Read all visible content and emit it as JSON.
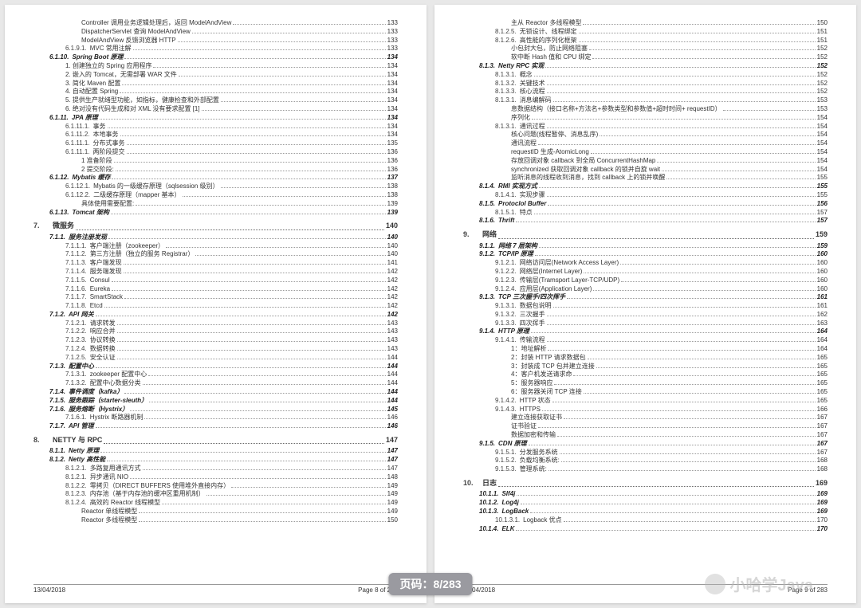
{
  "footer_date": "13/04/2018",
  "left_footer": "Page 8 of 283",
  "right_footer": "Page 9 of 283",
  "badge": "页码：8/283",
  "watermark": "小哈学Java",
  "left": [
    {
      "i": 3,
      "n": "",
      "t": "Controller 调用业务逻辑处理后，返回 ModelAndView",
      "p": "133"
    },
    {
      "i": 3,
      "n": "",
      "t": "DispatcherServlet 查询 ModelAndView",
      "p": "133"
    },
    {
      "i": 3,
      "n": "",
      "t": "ModelAndView 反馈浏览器 HTTP",
      "p": "133"
    },
    {
      "i": 2,
      "n": "6.1.9.1.",
      "t": "MVC 常用注解",
      "p": "133"
    },
    {
      "i": 1,
      "n": "6.1.10.",
      "t": "Spring Boot 原理",
      "p": "134",
      "style": "italic"
    },
    {
      "i": 2,
      "n": "",
      "t": "1. 创建独立的 Spring 应用程序",
      "p": "134"
    },
    {
      "i": 2,
      "n": "",
      "t": "2. 嵌入的 Tomcat，无需部署 WAR 文件",
      "p": "134"
    },
    {
      "i": 2,
      "n": "",
      "t": "3. 简化 Maven 配置",
      "p": "134"
    },
    {
      "i": 2,
      "n": "",
      "t": "4. 自动配置 Spring",
      "p": "134"
    },
    {
      "i": 2,
      "n": "",
      "t": "5. 提供生产就绪型功能，如指标，健康检查和外部配置",
      "p": "134"
    },
    {
      "i": 2,
      "n": "",
      "t": "6. 绝对没有代码生成和对 XML 没有要求配置 [1]",
      "p": "134"
    },
    {
      "i": 1,
      "n": "6.1.11.",
      "t": "JPA 原理",
      "p": "134",
      "style": "italic"
    },
    {
      "i": 2,
      "n": "6.1.11.1.",
      "t": "事务",
      "p": "134"
    },
    {
      "i": 2,
      "n": "6.1.11.2.",
      "t": "本地事务",
      "p": "134"
    },
    {
      "i": 2,
      "n": "6.1.11.1.",
      "t": "分布式事务",
      "p": "135"
    },
    {
      "i": 2,
      "n": "6.1.11.1.",
      "t": "两阶段提交",
      "p": "136"
    },
    {
      "i": 3,
      "n": "",
      "t": "1 准备阶段",
      "p": "136"
    },
    {
      "i": 3,
      "n": "",
      "t": "2 提交阶段:",
      "p": "136"
    },
    {
      "i": 1,
      "n": "6.1.12.",
      "t": "Mybatis 缓存",
      "p": "137",
      "style": "italic"
    },
    {
      "i": 2,
      "n": "6.1.12.1.",
      "t": "Mybatis 的一级缓存原理（sqlsession 级别）",
      "p": "138"
    },
    {
      "i": 2,
      "n": "6.1.12.2.",
      "t": "二级缓存原理（mapper 基本）",
      "p": "138"
    },
    {
      "i": 3,
      "n": "",
      "t": "具体使用需要配置:",
      "p": "139"
    },
    {
      "i": 1,
      "n": "6.1.13.",
      "t": "Tomcat 架构",
      "p": "139",
      "style": "italic"
    },
    {
      "i": 0,
      "n": "7.",
      "t": "微服务",
      "p": "140",
      "style": "chapter"
    },
    {
      "i": 1,
      "n": "7.1.1.",
      "t": "服务注册发现",
      "p": "140",
      "style": "italic"
    },
    {
      "i": 2,
      "n": "7.1.1.1.",
      "t": "客户端注册（zookeeper）",
      "p": "140"
    },
    {
      "i": 2,
      "n": "7.1.1.2.",
      "t": "第三方注册（独立的服务 Registrar）",
      "p": "140"
    },
    {
      "i": 2,
      "n": "7.1.1.3.",
      "t": "客户端发现",
      "p": "141"
    },
    {
      "i": 2,
      "n": "7.1.1.4.",
      "t": "服务端发现",
      "p": "142"
    },
    {
      "i": 2,
      "n": "7.1.1.5.",
      "t": "Consul",
      "p": "142"
    },
    {
      "i": 2,
      "n": "7.1.1.6.",
      "t": "Eureka",
      "p": "142"
    },
    {
      "i": 2,
      "n": "7.1.1.7.",
      "t": "SmartStack",
      "p": "142"
    },
    {
      "i": 2,
      "n": "7.1.1.8.",
      "t": "Etcd",
      "p": "142"
    },
    {
      "i": 1,
      "n": "7.1.2.",
      "t": "API 网关",
      "p": "142",
      "style": "italic"
    },
    {
      "i": 2,
      "n": "7.1.2.1.",
      "t": "请求转发",
      "p": "143"
    },
    {
      "i": 2,
      "n": "7.1.2.2.",
      "t": "响应合并",
      "p": "143"
    },
    {
      "i": 2,
      "n": "7.1.2.3.",
      "t": "协议转换",
      "p": "143"
    },
    {
      "i": 2,
      "n": "7.1.2.4.",
      "t": "数据转换",
      "p": "143"
    },
    {
      "i": 2,
      "n": "7.1.2.5.",
      "t": "安全认证",
      "p": "144"
    },
    {
      "i": 1,
      "n": "7.1.3.",
      "t": "配置中心",
      "p": "144",
      "style": "italic"
    },
    {
      "i": 2,
      "n": "7.1.3.1.",
      "t": "zookeeper 配置中心",
      "p": "144"
    },
    {
      "i": 2,
      "n": "7.1.3.2.",
      "t": "配置中心数据分类",
      "p": "144"
    },
    {
      "i": 1,
      "n": "7.1.4.",
      "t": "事件调度（kafka）",
      "p": "144",
      "style": "italic"
    },
    {
      "i": 1,
      "n": "7.1.5.",
      "t": "服务跟踪（starter-sleuth）",
      "p": "144",
      "style": "italic"
    },
    {
      "i": 1,
      "n": "7.1.6.",
      "t": "服务熔断（Hystrix）",
      "p": "145",
      "style": "italic"
    },
    {
      "i": 2,
      "n": "7.1.6.1.",
      "t": "Hystrix 断路器机制",
      "p": "146"
    },
    {
      "i": 1,
      "n": "7.1.7.",
      "t": "API 管理",
      "p": "146",
      "style": "italic"
    },
    {
      "i": 0,
      "n": "8.",
      "t": "NETTY 与 RPC",
      "p": "147",
      "style": "chapter"
    },
    {
      "i": 1,
      "n": "8.1.1.",
      "t": "Netty 原理",
      "p": "147",
      "style": "italic"
    },
    {
      "i": 1,
      "n": "8.1.2.",
      "t": "Netty 高性能",
      "p": "147",
      "style": "italic"
    },
    {
      "i": 2,
      "n": "8.1.2.1.",
      "t": "多路复用通讯方式",
      "p": "147"
    },
    {
      "i": 2,
      "n": "8.1.2.1.",
      "t": "异步通讯 NIO",
      "p": "148"
    },
    {
      "i": 2,
      "n": "8.1.2.2.",
      "t": "零拷贝（DIRECT BUFFERS 使用堆外直接内存）",
      "p": "149"
    },
    {
      "i": 2,
      "n": "8.1.2.3.",
      "t": "内存池（基于内存池的缓冲区重用机制）",
      "p": "149"
    },
    {
      "i": 2,
      "n": "8.1.2.4.",
      "t": "高效的 Reactor 线程模型",
      "p": "149"
    },
    {
      "i": 3,
      "n": "",
      "t": "Reactor 单线程模型",
      "p": "149"
    },
    {
      "i": 3,
      "n": "",
      "t": "Reactor 多线程模型",
      "p": "150"
    }
  ],
  "right": [
    {
      "i": 3,
      "n": "",
      "t": "主从 Reactor 多线程模型",
      "p": "150"
    },
    {
      "i": 2,
      "n": "8.1.2.5.",
      "t": "无锁设计、线程绑定",
      "p": "151"
    },
    {
      "i": 2,
      "n": "8.1.2.6.",
      "t": "高性能的序列化框架",
      "p": "151"
    },
    {
      "i": 3,
      "n": "",
      "t": "小包封大包，防止网络阻塞",
      "p": "152"
    },
    {
      "i": 3,
      "n": "",
      "t": "软中断 Hash 值和 CPU 绑定",
      "p": "152"
    },
    {
      "i": 1,
      "n": "8.1.3.",
      "t": "Netty RPC 实现",
      "p": "152",
      "style": "italic"
    },
    {
      "i": 2,
      "n": "8.1.3.1.",
      "t": "概念",
      "p": "152"
    },
    {
      "i": 2,
      "n": "8.1.3.2.",
      "t": "关键技术",
      "p": "152"
    },
    {
      "i": 2,
      "n": "8.1.3.3.",
      "t": "核心流程",
      "p": "152"
    },
    {
      "i": 2,
      "n": "8.1.3.1.",
      "t": "消息编解码",
      "p": "153"
    },
    {
      "i": 3,
      "n": "",
      "t": "息数据结构（接口名称+方法名+参数类型和参数值+超时时间+ requestID）",
      "p": "153"
    },
    {
      "i": 3,
      "n": "",
      "t": "序列化",
      "p": "154"
    },
    {
      "i": 2,
      "n": "8.1.3.1.",
      "t": "通讯过程",
      "p": "154"
    },
    {
      "i": 3,
      "n": "",
      "t": "核心问题(线程暂停、消息乱序)",
      "p": "154"
    },
    {
      "i": 3,
      "n": "",
      "t": "通讯流程",
      "p": "154"
    },
    {
      "i": 3,
      "n": "",
      "t": "requestID 生成-AtomicLong",
      "p": "154"
    },
    {
      "i": 3,
      "n": "",
      "t": "存放回调对象 callback 到全局 ConcurrentHashMap",
      "p": "154"
    },
    {
      "i": 3,
      "n": "",
      "t": "synchronized 获取回调对象 callback 的锁并自旋 wait",
      "p": "154"
    },
    {
      "i": 3,
      "n": "",
      "t": "监听消息的线程收到消息，找到 callback 上的锁并唤醒",
      "p": "155"
    },
    {
      "i": 1,
      "n": "8.1.4.",
      "t": "RMI 实现方式",
      "p": "155",
      "style": "italic"
    },
    {
      "i": 2,
      "n": "8.1.4.1.",
      "t": "实现步骤",
      "p": "155"
    },
    {
      "i": 1,
      "n": "8.1.5.",
      "t": "Protoclol Buffer",
      "p": "156",
      "style": "italic"
    },
    {
      "i": 2,
      "n": "8.1.5.1.",
      "t": "特点",
      "p": "157"
    },
    {
      "i": 1,
      "n": "8.1.6.",
      "t": "Thrift",
      "p": "157",
      "style": "italic"
    },
    {
      "i": 0,
      "n": "9.",
      "t": "网络",
      "p": "159",
      "style": "chapter"
    },
    {
      "i": 1,
      "n": "9.1.1.",
      "t": "网络 7 层架构",
      "p": "159",
      "style": "italic"
    },
    {
      "i": 1,
      "n": "9.1.2.",
      "t": "TCP/IP 原理",
      "p": "160",
      "style": "italic"
    },
    {
      "i": 2,
      "n": "9.1.2.1.",
      "t": "网络访问层(Network Access Layer)",
      "p": "160"
    },
    {
      "i": 2,
      "n": "9.1.2.2.",
      "t": "网络层(Internet Layer)",
      "p": "160"
    },
    {
      "i": 2,
      "n": "9.1.2.3.",
      "t": "传输层(Tramsport Layer-TCP/UDP)",
      "p": "160"
    },
    {
      "i": 2,
      "n": "9.1.2.4.",
      "t": "应用层(Application Layer)",
      "p": "160"
    },
    {
      "i": 1,
      "n": "9.1.3.",
      "t": "TCP 三次握手/四次挥手",
      "p": "161",
      "style": "italic"
    },
    {
      "i": 2,
      "n": "9.1.3.1.",
      "t": "数据包说明",
      "p": "161"
    },
    {
      "i": 2,
      "n": "9.1.3.2.",
      "t": "三次握手",
      "p": "162"
    },
    {
      "i": 2,
      "n": "9.1.3.3.",
      "t": "四次挥手",
      "p": "163"
    },
    {
      "i": 1,
      "n": "9.1.4.",
      "t": "HTTP 原理",
      "p": "164",
      "style": "italic"
    },
    {
      "i": 2,
      "n": "9.1.4.1.",
      "t": "传输流程",
      "p": "164"
    },
    {
      "i": 3,
      "n": "",
      "t": "1：地址解析",
      "p": "164"
    },
    {
      "i": 3,
      "n": "",
      "t": "2：封装 HTTP 请求数据包",
      "p": "165"
    },
    {
      "i": 3,
      "n": "",
      "t": "3：封装成 TCP 包并建立连接",
      "p": "165"
    },
    {
      "i": 3,
      "n": "",
      "t": "4：客户机发送请求命",
      "p": "165"
    },
    {
      "i": 3,
      "n": "",
      "t": "5：服务器响应",
      "p": "165"
    },
    {
      "i": 3,
      "n": "",
      "t": "6：服务器关闭 TCP 连接",
      "p": "165"
    },
    {
      "i": 2,
      "n": "9.1.4.2.",
      "t": "HTTP 状态",
      "p": "165"
    },
    {
      "i": 2,
      "n": "9.1.4.3.",
      "t": "HTTPS",
      "p": "166"
    },
    {
      "i": 3,
      "n": "",
      "t": "建立连接获取证书",
      "p": "167"
    },
    {
      "i": 3,
      "n": "",
      "t": "证书验证",
      "p": "167"
    },
    {
      "i": 3,
      "n": "",
      "t": "数据加密和传输",
      "p": "167"
    },
    {
      "i": 1,
      "n": "9.1.5.",
      "t": "CDN 原理",
      "p": "167",
      "style": "italic"
    },
    {
      "i": 2,
      "n": "9.1.5.1.",
      "t": "分发服务系统",
      "p": "167"
    },
    {
      "i": 2,
      "n": "9.1.5.2.",
      "t": "负载均衡系统:",
      "p": "168"
    },
    {
      "i": 2,
      "n": "9.1.5.3.",
      "t": "管理系统:",
      "p": "168"
    },
    {
      "i": 0,
      "n": "10.",
      "t": "日志",
      "p": "169",
      "style": "chapter"
    },
    {
      "i": 1,
      "n": "10.1.1.",
      "t": "Slf4j",
      "p": "169",
      "style": "italic"
    },
    {
      "i": 1,
      "n": "10.1.2.",
      "t": "Log4j",
      "p": "169",
      "style": "italic"
    },
    {
      "i": 1,
      "n": "10.1.3.",
      "t": "LogBack",
      "p": "169",
      "style": "italic"
    },
    {
      "i": 2,
      "n": "10.1.3.1.",
      "t": "Logback 优点",
      "p": "170"
    },
    {
      "i": 1,
      "n": "10.1.4.",
      "t": "ELK",
      "p": "170",
      "style": "italic"
    }
  ]
}
